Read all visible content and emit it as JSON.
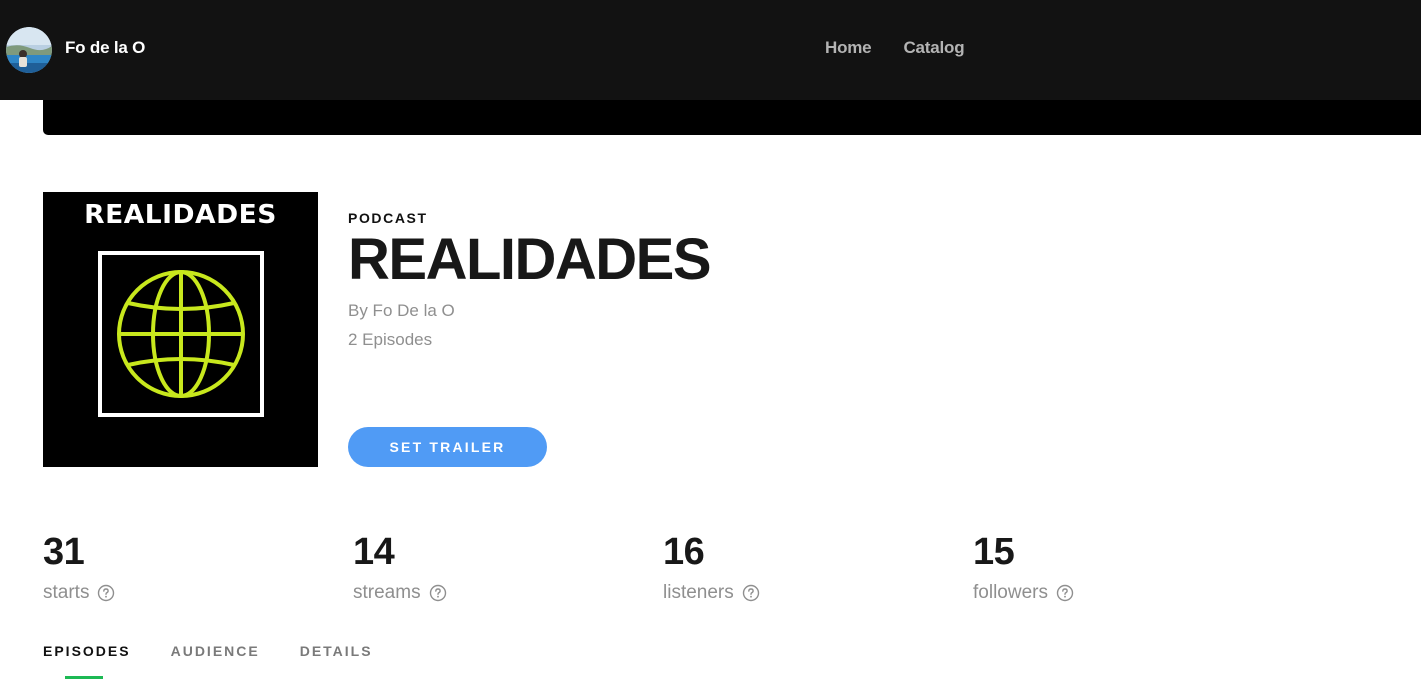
{
  "topbar": {
    "account_name": "Fo de la O",
    "nav": [
      {
        "label": "Home"
      },
      {
        "label": "Catalog"
      }
    ]
  },
  "banner": {
    "text": "",
    "link_text": ""
  },
  "podcast": {
    "cover_title": "REALIDADES",
    "kind": "PODCAST",
    "title": "REALIDADES",
    "byline": "By Fo De la O",
    "episodes": "2 Episodes",
    "trailer_button": "SET TRAILER"
  },
  "stats": [
    {
      "value": "31",
      "label": "starts"
    },
    {
      "value": "14",
      "label": "streams"
    },
    {
      "value": "16",
      "label": "listeners"
    },
    {
      "value": "15",
      "label": "followers"
    }
  ],
  "tabs": [
    {
      "label": "EPISODES",
      "active": true
    },
    {
      "label": "AUDIENCE",
      "active": false
    },
    {
      "label": "DETAILS",
      "active": false
    }
  ],
  "colors": {
    "topbar_bg": "#121212",
    "accent_button": "#509bf5",
    "tab_underline": "#1db954",
    "cover_globe": "#c8e81d"
  }
}
